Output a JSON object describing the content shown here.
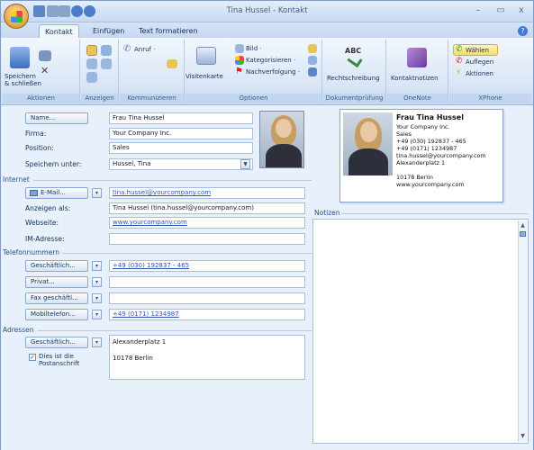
{
  "window": {
    "title": "Tina Hussel - Kontakt",
    "controls": {
      "minimize": "–",
      "maximize": "▭",
      "close": "x"
    }
  },
  "ribbon": {
    "tabs": [
      "Kontakt",
      "Einfügen",
      "Text formatieren"
    ],
    "groups": {
      "aktionen": {
        "label": "Aktionen",
        "save_close": "Speichern\n& schließen"
      },
      "anzeigen": {
        "label": "Anzeigen"
      },
      "kommunizieren": {
        "label": "Kommunizieren",
        "call": "Anruf ·"
      },
      "optionen": {
        "label": "Optionen",
        "visitenkarte": "Visitenkarte",
        "bild": "Bild ·",
        "kategorisieren": "Kategorisieren ·",
        "nachverfolgung": "Nachverfolgung ·"
      },
      "dokumentpruefung": {
        "label": "Dokumentprüfung",
        "rechtschreibung": "Rechtschreibung",
        "abc": "ABC"
      },
      "onenote": {
        "label": "OneNote",
        "kontaktnotizen": "Kontaktnotizen"
      },
      "xphone": {
        "label": "XPhone",
        "waehlen": "Wählen",
        "auflegen": "Auflegen",
        "aktionen": "Aktionen"
      }
    }
  },
  "form": {
    "name_button": "Name...",
    "name": "Frau Tina Hussel",
    "firma_label": "Firma:",
    "firma": "Your Company Inc.",
    "position_label": "Position:",
    "position": "Sales",
    "speichern_label": "Speichern unter:",
    "speichern": "Hussel, Tina",
    "internet_section": "Internet",
    "email_button": "E-Mail...",
    "email": "tina.hussel@yourcompany.com",
    "anzeigen_label": "Anzeigen als:",
    "anzeigen": "Tina Hussel (tina.hussel@yourcompany.com)",
    "webseite_label": "Webseite:",
    "webseite": "www.yourcompany.com",
    "im_label": "IM-Adresse:",
    "im": "",
    "telefon_section": "Telefonnummern",
    "phones": [
      {
        "button": "Geschäftlich...",
        "value": "+49 (030) 192837 - 465"
      },
      {
        "button": "Privat...",
        "value": ""
      },
      {
        "button": "Fax geschäftl...",
        "value": ""
      },
      {
        "button": "Mobiltelefon...",
        "value": "+49 (0171) 1234987"
      }
    ],
    "adressen_section": "Adressen",
    "address_button": "Geschäftlich...",
    "address_line1": "Alexanderplatz 1",
    "address_line2": "10178 Berlin",
    "postal_checkbox": "Dies ist die\nPostanschrift"
  },
  "vcard": {
    "name": "Frau Tina Hussel",
    "company": "Your Company Inc.",
    "position": "Sales",
    "phone1": "+49 (030) 192837 - 465",
    "phone2": "+49 (0171) 1234987",
    "email": "tina.hussel@yourcompany.com",
    "street": "Alexanderplatz 1",
    "city": "10178 Berlin",
    "web": "www.yourcompany.com"
  },
  "notes": {
    "label": "Notizen"
  }
}
